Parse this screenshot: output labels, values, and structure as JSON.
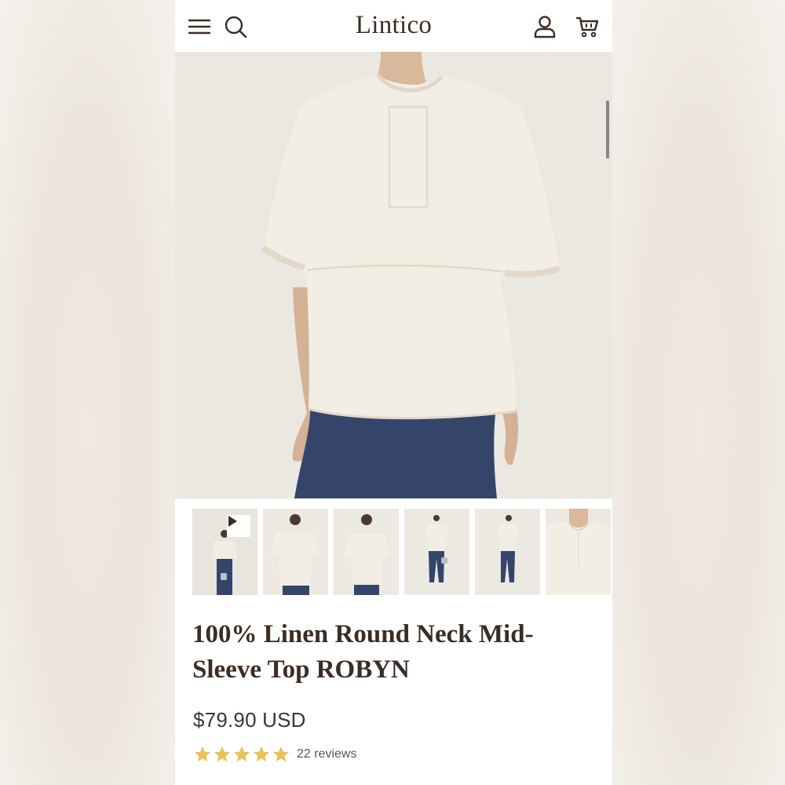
{
  "header": {
    "logo": "Lintico",
    "menu_icon": "hamburger-menu-icon",
    "search_icon": "search-icon",
    "account_icon": "user-account-icon",
    "cart_icon": "shopping-cart-icon"
  },
  "gallery": {
    "thumbnails": [
      {
        "label": "video",
        "icon": "play-icon"
      },
      {
        "label": "back view"
      },
      {
        "label": "front view"
      },
      {
        "label": "full body front"
      },
      {
        "label": "full body side"
      },
      {
        "label": "neckline detail"
      }
    ]
  },
  "product": {
    "title": "100% Linen Round Neck Mid-Sleeve Top ROBYN",
    "price": "$79.90 USD",
    "rating": 5,
    "reviews": "22 reviews"
  },
  "colors": {
    "brand_text": "#3a2d24",
    "star": "#e8c25a",
    "top_fabric": "#f3eee4",
    "pants": "#35456a"
  }
}
